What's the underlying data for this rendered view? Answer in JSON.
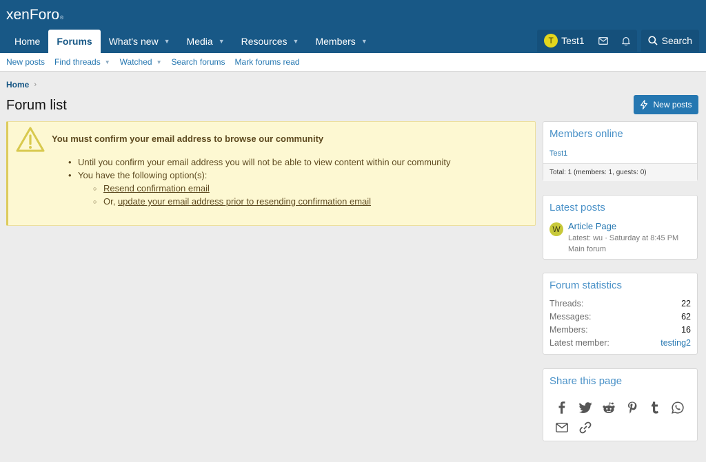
{
  "logo": {
    "part1": "xen",
    "part2": "Foro",
    "mark": "®"
  },
  "nav": {
    "tabs": [
      {
        "label": "Home",
        "caret": false,
        "active": false
      },
      {
        "label": "Forums",
        "caret": false,
        "active": true
      },
      {
        "label": "What's new",
        "caret": true,
        "active": false
      },
      {
        "label": "Media",
        "caret": true,
        "active": false
      },
      {
        "label": "Resources",
        "caret": true,
        "active": false
      },
      {
        "label": "Members",
        "caret": true,
        "active": false
      }
    ]
  },
  "user": {
    "avatar_letter": "T",
    "name": "Test1",
    "search_label": "Search"
  },
  "subnav": {
    "new_posts": "New posts",
    "find_threads": "Find threads",
    "watched": "Watched",
    "search_forums": "Search forums",
    "mark_read": "Mark forums read"
  },
  "breadcrumb": {
    "home": "Home"
  },
  "page": {
    "title": "Forum list",
    "new_posts_button": "New posts"
  },
  "notice": {
    "title": "You must confirm your email address to browse our community",
    "line1": "Until you confirm your email address you will not be able to view content within our community",
    "line2": "You have the following option(s):",
    "option1_link": "Resend confirmation email",
    "option2_prefix": "Or, ",
    "option2_link": "update your email address prior to resending confirmation email"
  },
  "members_online": {
    "title": "Members online",
    "user": "Test1",
    "total": "Total: 1 (members: 1, guests: 0)"
  },
  "latest_posts": {
    "title": "Latest posts",
    "avatar_letter": "W",
    "post_title": "Article Page",
    "meta": "Latest: wu · Saturday at 8:45 PM",
    "forum": "Main forum"
  },
  "forum_stats": {
    "title": "Forum statistics",
    "threads_label": "Threads:",
    "threads": "22",
    "messages_label": "Messages:",
    "messages": "62",
    "members_label": "Members:",
    "members": "16",
    "latest_label": "Latest member:",
    "latest": "testing2"
  },
  "share": {
    "title": "Share this page",
    "icons": [
      "facebook-icon",
      "twitter-icon",
      "reddit-icon",
      "pinterest-icon",
      "tumblr-icon",
      "whatsapp-icon",
      "email-icon",
      "link-icon"
    ]
  },
  "colors": {
    "header": "#185886",
    "accent": "#2577b1",
    "notice_bg": "#fdf8d2",
    "notice_text": "#5e4a20"
  }
}
